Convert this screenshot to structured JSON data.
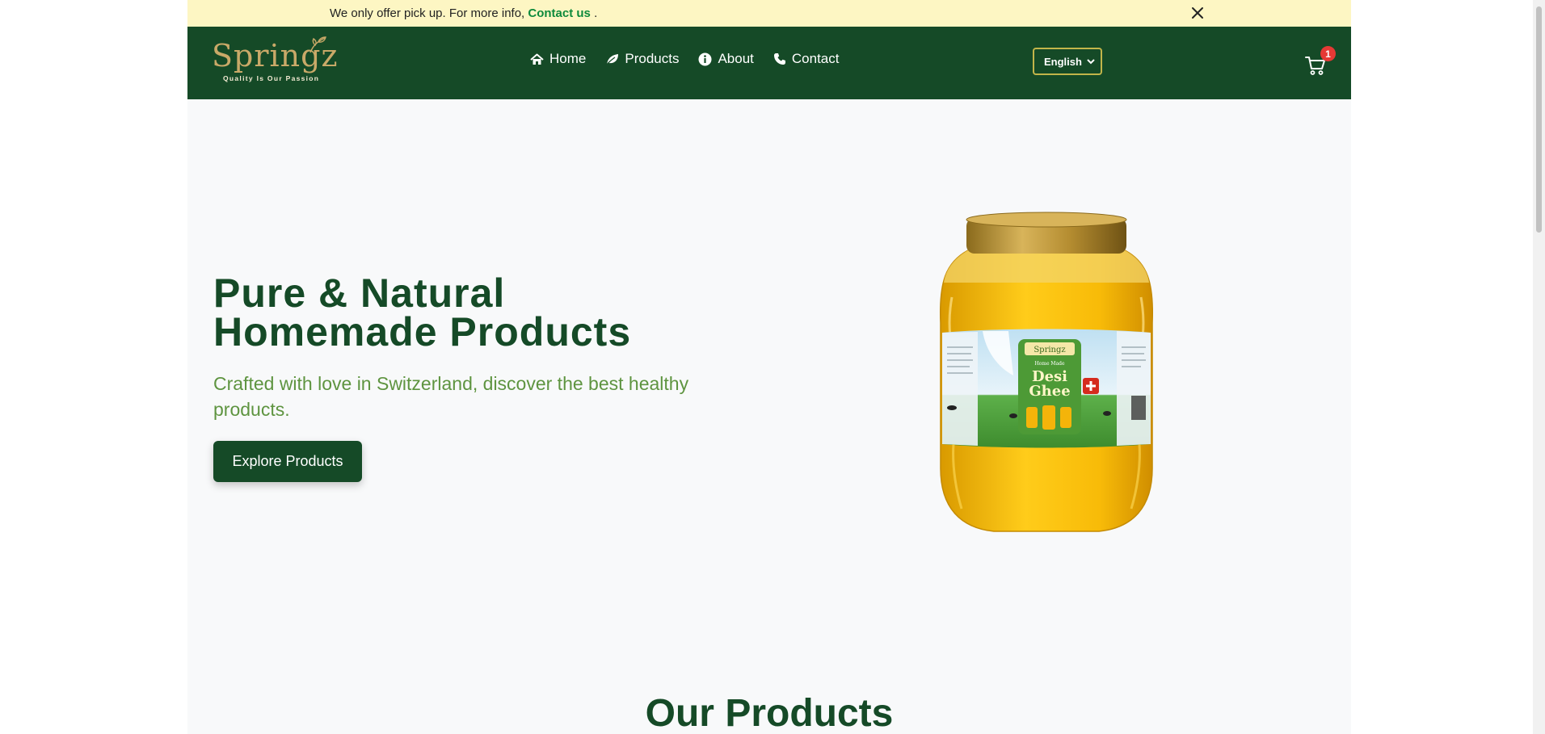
{
  "announcement": {
    "text": "We only offer pick up. For more info, ",
    "link_text": "Contact us",
    "suffix": " ."
  },
  "brand": {
    "name": "Springz",
    "tagline": "Quality Is Our Passion"
  },
  "nav": {
    "home": "Home",
    "products": "Products",
    "about": "About",
    "contact": "Contact"
  },
  "language": {
    "selected": "English"
  },
  "cart": {
    "count": "1"
  },
  "hero": {
    "title_line1": "Pure & Natural",
    "title_line2": "Homemade Products",
    "subtitle": "Crafted with love in Switzerland, discover the best healthy products.",
    "cta": "Explore Products"
  },
  "jar_label": {
    "brand": "Springz",
    "line1": "Home Made",
    "line2": "Desi",
    "line3": "Ghee"
  },
  "sections": {
    "products_title": "Our Products"
  },
  "colors": {
    "primary": "#154a27",
    "accent_gold": "#c9a968",
    "announce_bg": "#fdf6c3",
    "link_green": "#0e8a3c",
    "subtitle_green": "#5e9440",
    "badge_red": "#e53935"
  },
  "icons": [
    "close-icon",
    "home-icon",
    "leaf-icon",
    "info-icon",
    "phone-icon",
    "chevron-down-icon",
    "cart-icon",
    "leaf-logo-icon"
  ]
}
